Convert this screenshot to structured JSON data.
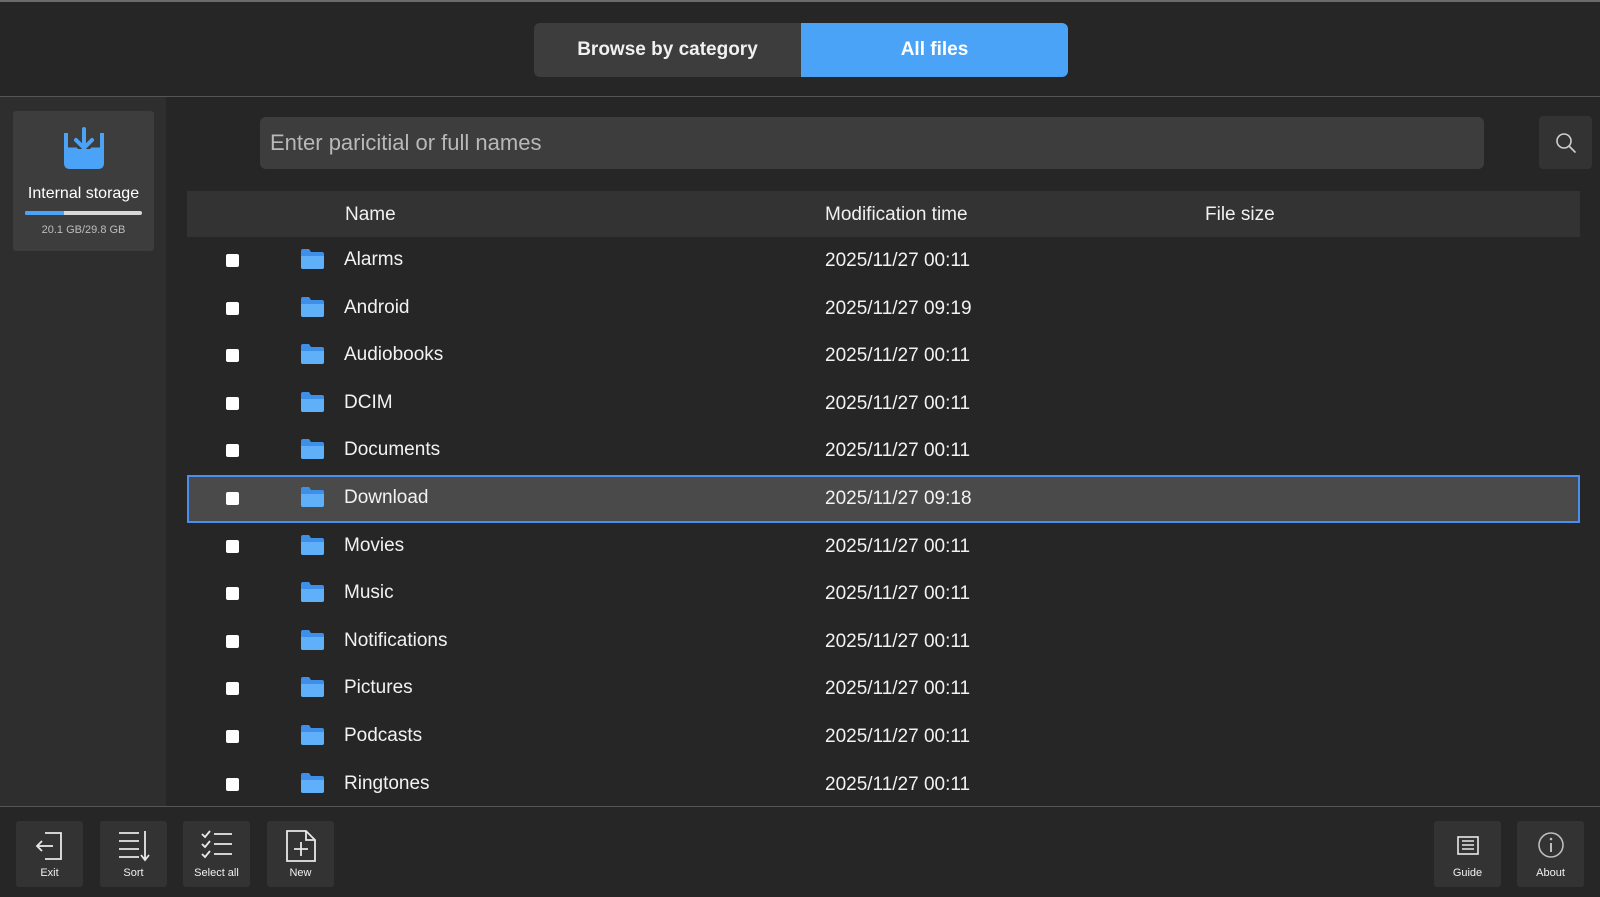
{
  "tabs": [
    {
      "label": "Browse by category",
      "active": false
    },
    {
      "label": "All files",
      "active": true
    }
  ],
  "storage": {
    "name": "Internal storage",
    "size_text": "20.1 GB/29.8 GB",
    "used_fraction": 0.33
  },
  "search": {
    "placeholder": "Enter paricitial or full names",
    "value": ""
  },
  "table": {
    "headers": {
      "name": "Name",
      "time": "Modification time",
      "size": "File size"
    },
    "rows": [
      {
        "name": "Alarms",
        "time": "2025/11/27 00:11",
        "selected": false
      },
      {
        "name": "Android",
        "time": "2025/11/27 09:19",
        "selected": false
      },
      {
        "name": "Audiobooks",
        "time": "2025/11/27 00:11",
        "selected": false
      },
      {
        "name": "DCIM",
        "time": "2025/11/27 00:11",
        "selected": false
      },
      {
        "name": "Documents",
        "time": "2025/11/27 00:11",
        "selected": false
      },
      {
        "name": "Download",
        "time": "2025/11/27 09:18",
        "selected": true
      },
      {
        "name": "Movies",
        "time": "2025/11/27 00:11",
        "selected": false
      },
      {
        "name": "Music",
        "time": "2025/11/27 00:11",
        "selected": false
      },
      {
        "name": "Notifications",
        "time": "2025/11/27 00:11",
        "selected": false
      },
      {
        "name": "Pictures",
        "time": "2025/11/27 00:11",
        "selected": false
      },
      {
        "name": "Podcasts",
        "time": "2025/11/27 00:11",
        "selected": false
      },
      {
        "name": "Ringtones",
        "time": "2025/11/27 00:11",
        "selected": false
      }
    ]
  },
  "toolbar": {
    "exit": "Exit",
    "sort": "Sort",
    "select_all": "Select all",
    "new": "New",
    "guide": "Guide",
    "about": "About"
  },
  "colors": {
    "accent": "#4aa3f7",
    "selection_border": "#4a8ef0",
    "background": "#262626"
  }
}
